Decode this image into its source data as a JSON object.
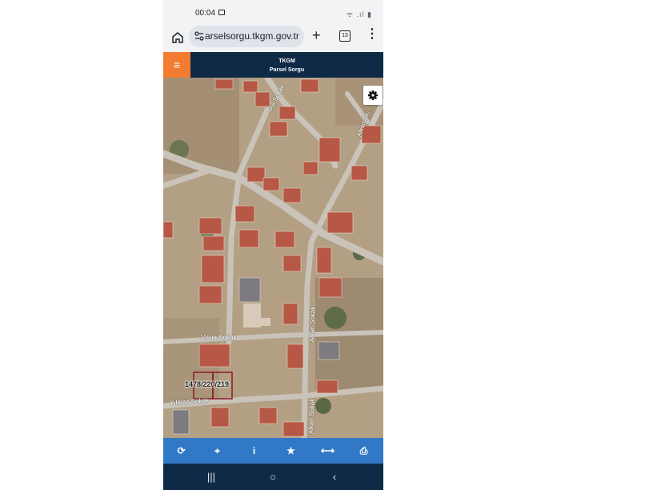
{
  "status_bar": {
    "time": "00:04",
    "indicators": "ᯤ .ıl ▮"
  },
  "browser": {
    "url": "arselsorgu.tkgm.gov.tr",
    "tab_count": "13",
    "plus_glyph": "+",
    "menu_glyph": "⋮"
  },
  "app": {
    "menu_glyph": "≡",
    "title_line1": "TKGM",
    "title_line2": "Parsel Sorgu"
  },
  "map": {
    "parcel_label": "1478/220/219",
    "streets": {
      "visne": "Vişne Sokak",
      "yilmaz": "Yılmaz Sokak",
      "alkan_mid": "Alkan Sokak",
      "alkan_bottom": "Alkan Sokak",
      "alkan_top": "Alkan Sk.",
      "top_left": "Gül Sokak"
    }
  },
  "toolbar": {
    "refresh": "⟳",
    "locate": "⌖",
    "info": "i",
    "favorite": "★",
    "measure": "⟷",
    "print": "⎙"
  },
  "nav": {
    "recents": "|||",
    "home": "○",
    "back": "‹"
  },
  "colors": {
    "header": "#0e2a47",
    "menu_accent": "#f47c30",
    "toolbar": "#3178c6",
    "parcel_outline": "#8b0f1f"
  }
}
